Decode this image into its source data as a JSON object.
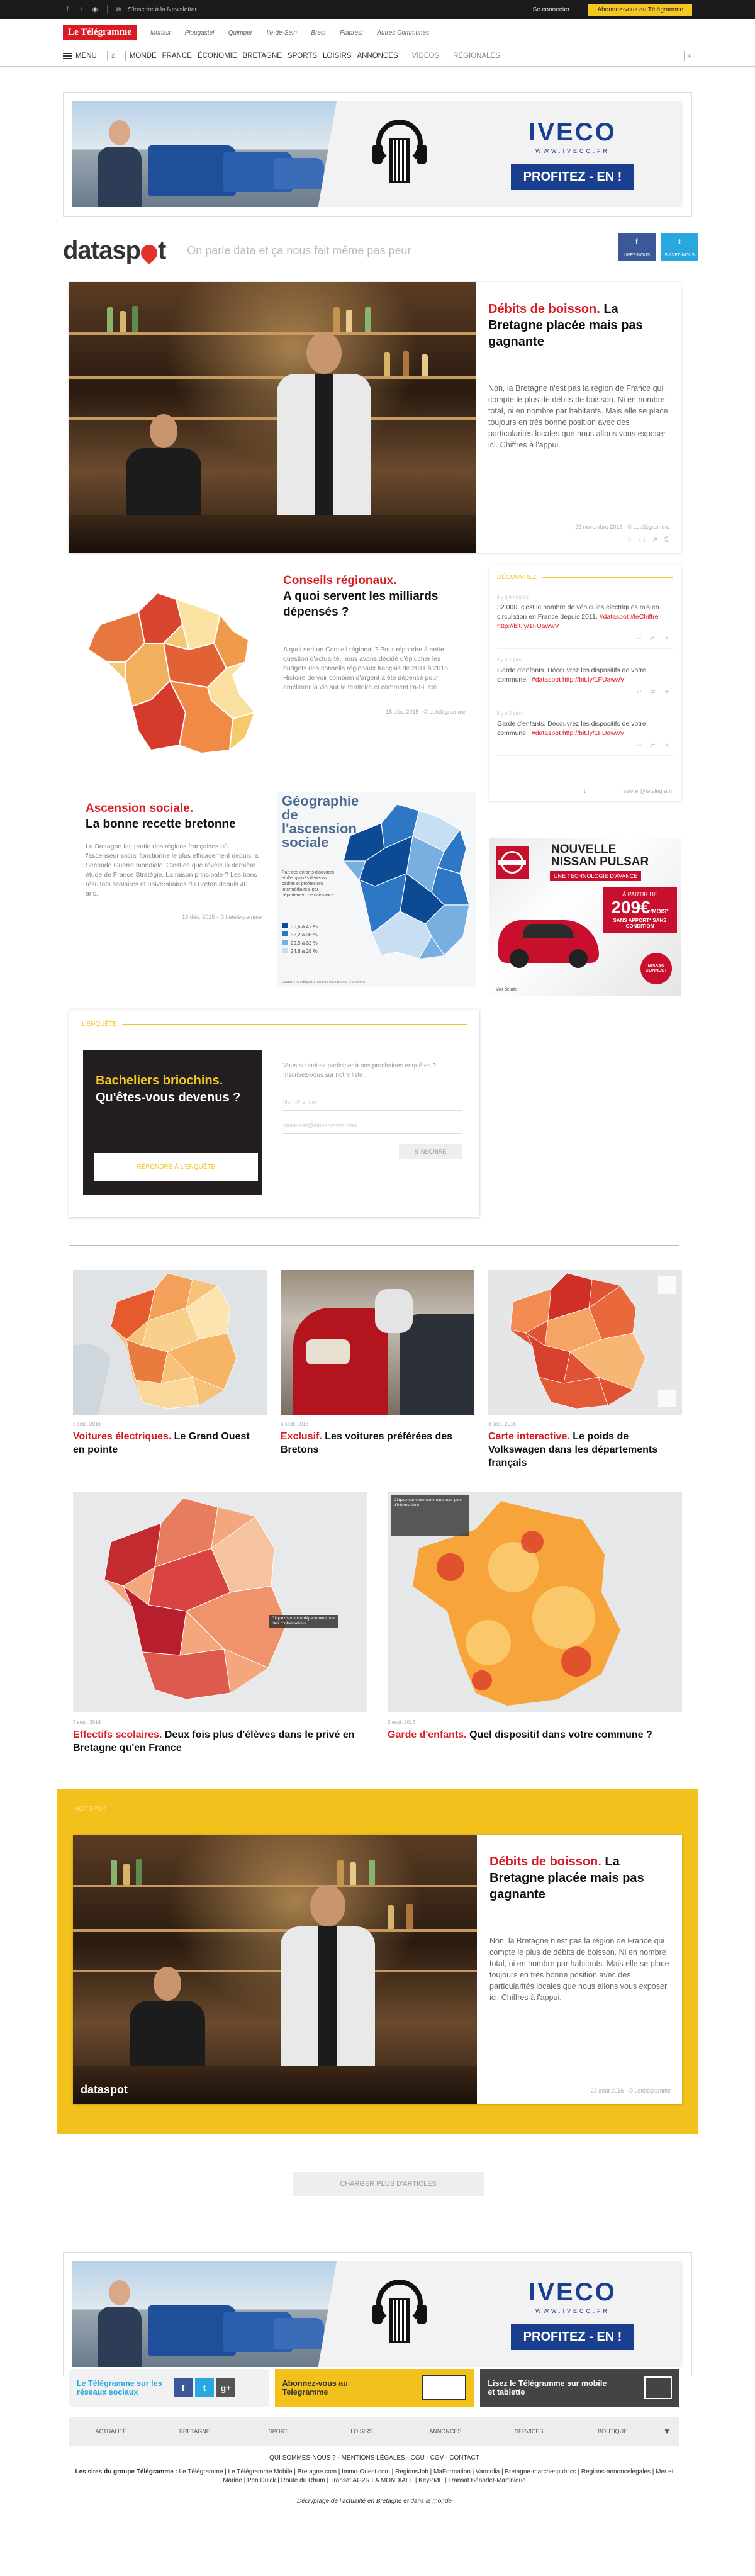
{
  "topbar": {
    "newsletter": "S'inscrire à la Newsletter",
    "login": "Se connecter",
    "subscribe": "Abonnez-vous au Télégramme"
  },
  "brand": {
    "logo": "Le Télégramme",
    "cities": [
      "Morlaix",
      "Plougastel",
      "Quimper",
      "Ile-de-Sein",
      "Brest",
      "Plabrest",
      "Autres Communes"
    ]
  },
  "nav": {
    "menu": "MENU",
    "items": [
      "MONDE",
      "FRANCE",
      "ÉCONOMIE",
      "BRETAGNE",
      "SPORTS",
      "LOISIRS",
      "ANNONCES"
    ],
    "muted": [
      "VIDÉOS",
      "RÉGIONALES"
    ]
  },
  "ad_iveco": {
    "brand": "IVECO",
    "url": "WWW.IVECO.FR",
    "cta": "PROFITEZ - EN !"
  },
  "dataspot": {
    "logo_start": "data",
    "logo_end": "sp",
    "logo_tail": "t",
    "tagline": "On parle data et ça nous fait même pas peur",
    "share_fb": "LIKEZ-NOUS",
    "share_tw": "SUIVEZ-NOUS"
  },
  "hero": {
    "title_red": "Débits de boisson.",
    "title_black": "La Bretagne placée mais pas gagnante",
    "text": "Non, la Bretagne n'est pas la région de France qui compte le plus de débits de boisson. Ni en nombre total, ni en nombre par habitants. Mais elle se place toujours en très bonne position avec des particularités locales que nous allons vous exposer ici. Chiffres à l'appui.",
    "date": "23 novembre 2016 - © Letélégramme"
  },
  "conseils": {
    "title_red": "Conseils régionaux.",
    "title_black": "A quoi servent les milliards dépensés ?",
    "text": "A quoi sert un Conseil régional ? Pour répondre à cette question d'actualité, nous avons décidé d'éplucher les budgets des conseils régionaux français de 2011 à 2015. Histoire de voir combien d'argent a été dépensé pour améliorer la vie sur le territoire et comment l'a-t-il été.",
    "date": "15 déc. 2015 - © Letélégramme"
  },
  "ascension": {
    "title_red": "Ascension sociale.",
    "title_black": "La bonne recette bretonne",
    "text": "La Bretagne fait partie des régions françaises où l'ascenseur social fonctionne le plus efficacement depuis la Seconde Guerre mondiale. C'est ce que révèle la dernière étude de France Stratégie. La raison principale ? Les bons résultats scolaires et universitaires du Breton depuis 40 ans.",
    "date": "13 déc. 2015 - © Letélégramme",
    "map_title": "Géographie de l'ascension sociale",
    "map_legend_intro": "Part des enfants d'ouvriers et d'employés devenus cadres et professions intermédiaires, par département de naissance",
    "legend": [
      "36,6 à 47 %",
      "32,2 à 36 %",
      "29,5 à 32 %",
      "24,6 à 28 %"
    ],
    "legend_colors": [
      "#0d4a94",
      "#2e77c4",
      "#79aee0",
      "#c8def2"
    ],
    "source": "Lecture: un département où les enfants d'ouvriers"
  },
  "tweets": {
    "head": "DÉCOUVREZ",
    "items": [
      {
        "date": "il y a 6 heures",
        "text": "32.000, c'est le nombre de véhicules électriques mis en circulation en France depuis 2011. ",
        "link": "#dataspot #leChiffre http://bit.ly/1FUawwV"
      },
      {
        "date": "il y a 1 jour",
        "text": "Garde d'enfants. Découvrez les dispositifs de votre commune ! ",
        "link": "#dataspot http://bit.ly/1FUawwV"
      },
      {
        "date": "il y a 2 jours",
        "text": "Garde d'enfants. Découvrez les dispositifs de votre commune ! ",
        "link": "#dataspot http://bit.ly/1FUawwV"
      }
    ],
    "follow": "suivre @letelegram"
  },
  "nissan": {
    "l1": "NOUVELLE",
    "l2": "NISSAN PULSAR",
    "l3": "UNE TECHNOLOGIE D'AVANCE",
    "price_intro": "À PARTIR DE",
    "price": "209€",
    "price_unit": "/MOIS*",
    "terms": "SANS APPORT* SANS CONDITION",
    "badge": "NISSAN CONNECT",
    "more": "Voir détails"
  },
  "enquete": {
    "head": "L'ENQUÊTE",
    "title_yellow": "Bacheliers briochins.",
    "title_white": "Qu'êtes-vous devenus ?",
    "cta": "RÉPONDRE À L'ENQUÊTE",
    "intro": "Vous souhaitez participer à nos prochaines enquêtes ? Inscrivez-vous sur notre liste.",
    "name_placeholder": "Nom Prénom",
    "email_placeholder": "monemail@monadresse.com",
    "submit": "S'INSCRIRE"
  },
  "grid_row1": [
    {
      "date": "3 sept. 2016",
      "red": "Voitures électriques.",
      "black": "Le Grand Ouest en pointe"
    },
    {
      "date": "3 sept. 2016",
      "red": "Exclusif.",
      "black": "Les voitures préférées des Bretons"
    },
    {
      "date": "3 sept. 2016",
      "red": "Carte interactive.",
      "black": "Le poids de Volkswagen dans les départements français"
    }
  ],
  "grid_row2": [
    {
      "date": "3 sept. 2016",
      "red": "Effectifs scolaires.",
      "black": "Deux fois plus d'élèves dans le privé en Bretagne qu'en France",
      "map_note": "Cliquez sur votre département pour plus d'informations"
    },
    {
      "date": "3 sept. 2016",
      "red": "Garde d'enfants.",
      "black": "Quel dispositif dans votre commune ?",
      "map_note": "Cliquez sur votre commune pour plus d'informations"
    }
  ],
  "hotspot": {
    "head": "HOT SPOT",
    "title_red": "Débits de boisson.",
    "title_black": "La Bretagne placée mais pas gagnante",
    "text": "Non, la Bretagne n'est pas la région de France qui compte le plus de débits de boisson. Ni en nombre total, ni en nombre par habitants. Mais elle se place toujours en très bonne position avec des particularités locales que nous allons vous exposer ici. Chiffres à l'appui.",
    "date": "23 août 2016 - © Letélégramme",
    "watermark": "dataspot"
  },
  "load_more": "CHARGER PLUS D'ARTICLES",
  "footer": {
    "social_text": "Le Télégramme sur les réseaux sociaux",
    "sub_text": "Abonnez-vous au Telegramme",
    "mobile_text": "Lisez le Télégramme sur mobile et tablette",
    "sitemap": [
      "ACTUALITÉ",
      "BRETAGNE",
      "SPORT",
      "LOISIRS",
      "ANNONCES",
      "SERVICES",
      "BOUTIQUE"
    ],
    "links": "QUI SOMMES-NOUS ? - MENTIONS LÉGALES - CGU - CGV - CONTACT",
    "group_label": "Les sites du groupe Télégramme :",
    "group": "Le Télégramme | Le Télégramme Mobile | Bretagne.com | Immo-Ouest.com | RegionsJob | MaFormation | Vandolia | Bretagne-marchespublics | Regions-annoncelegales | Mer et Marine | Pen Duick | Route du Rhum | Transat AG2R LA MONDIALE | KeyPME | Transat Bénodet-Martinique",
    "tagline": "Décryptage de l'actualité en Bretagne et dans le monde"
  },
  "colors": {
    "brand_red": "#d91c23",
    "accent_yellow": "#f3c623",
    "iveco_blue": "#1a3f8f",
    "facebook": "#3b5998",
    "twitter": "#29a8e0"
  }
}
